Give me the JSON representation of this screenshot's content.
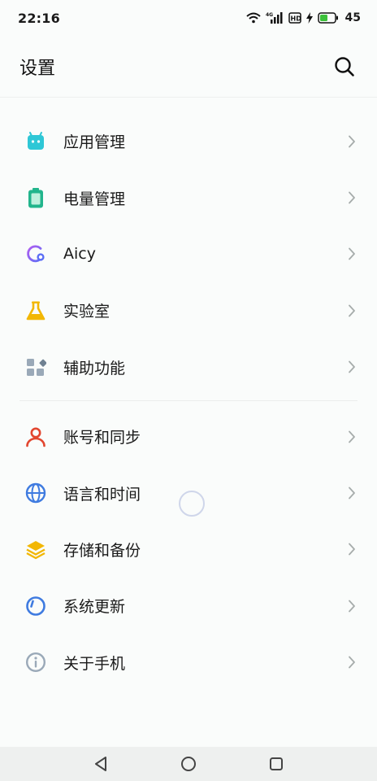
{
  "status_bar": {
    "time": "22:16",
    "network_badge": "4G",
    "hd_badge": "HD",
    "battery_level": "45",
    "battery_color": "#3cc13b"
  },
  "header": {
    "title": "设置"
  },
  "groups": [
    {
      "items": [
        {
          "label": "应用管理",
          "icon": "app-android-icon",
          "color": "#2ec7d6"
        },
        {
          "label": "电量管理",
          "icon": "battery-icon",
          "color": "#22b58c"
        },
        {
          "label": "Aicy",
          "icon": "aicy-icon",
          "color": "#7b5cf0"
        },
        {
          "label": "实验室",
          "icon": "flask-icon",
          "color": "#f2b705"
        },
        {
          "label": "辅助功能",
          "icon": "accessibility-grid-icon",
          "color": "#9aa9b8"
        }
      ]
    },
    {
      "items": [
        {
          "label": "账号和同步",
          "icon": "account-icon",
          "color": "#e2462f"
        },
        {
          "label": "语言和时间",
          "icon": "globe-icon",
          "color": "#3f7be0"
        },
        {
          "label": "存储和备份",
          "icon": "layers-icon",
          "color": "#f2b705"
        },
        {
          "label": "系统更新",
          "icon": "update-icon",
          "color": "#3f7be0"
        },
        {
          "label": "关于手机",
          "icon": "info-icon",
          "color": "#9aa9b8"
        }
      ]
    }
  ]
}
